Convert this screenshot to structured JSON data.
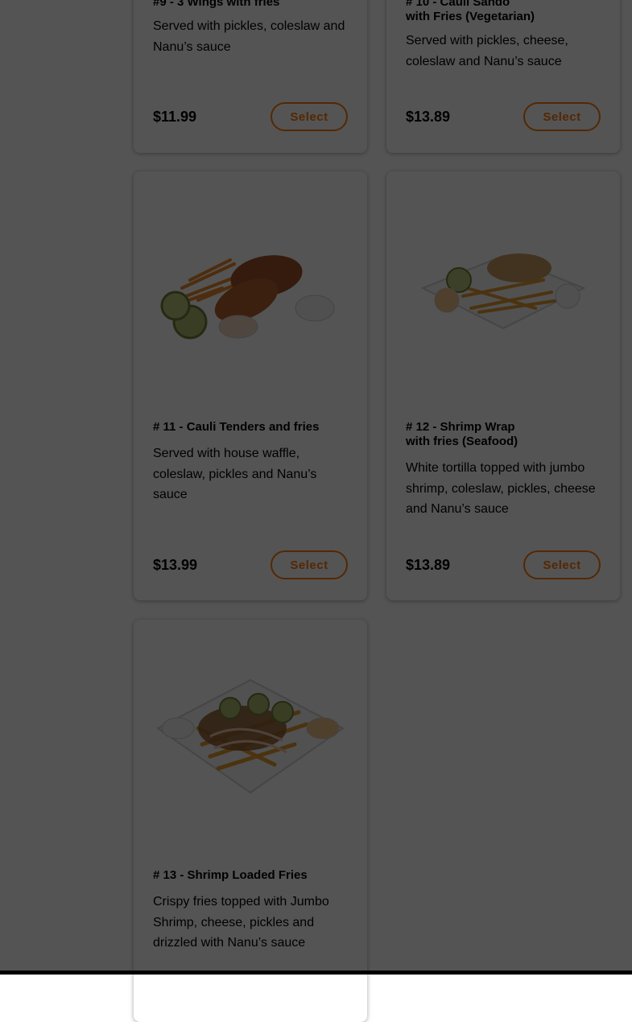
{
  "menu_items": [
    {
      "id": "item9",
      "title": "#9 - 3 Wings with fries",
      "description": "Served with pickles, coleslaw and Nanu’s sauce",
      "price": "$11.99",
      "select_label": "Select"
    },
    {
      "id": "item10",
      "title": "# 10 - Cauli Sando\nwith Fries (Vegetarian)",
      "description": "Served with pickles, cheese, coleslaw and Nanu’s sauce",
      "price": "$13.89",
      "select_label": "Select"
    },
    {
      "id": "item11",
      "title": "# 11 - Cauli Tenders and fries",
      "description": "Served with house waffle, coleslaw, pickles and Nanu’s sauce",
      "price": "$13.99",
      "select_label": "Select",
      "image_icon": "cauli-tenders-photo"
    },
    {
      "id": "item12",
      "title": "# 12 - Shrimp Wrap\nwith fries (Seafood)",
      "description": "White tortilla topped with jumbo shrimp, coleslaw, pickles, cheese and Nanu’s sauce",
      "price": "$13.89",
      "select_label": "Select",
      "image_icon": "shrimp-wrap-photo"
    },
    {
      "id": "item13",
      "title": "# 13 - Shrimp Loaded Fries",
      "description": "Crispy fries topped with Jumbo Shrimp, cheese, pickles and drizzled with Nanu’s sauce",
      "image_icon": "shrimp-loaded-fries-photo"
    }
  ],
  "colors": {
    "accent": "#fa7a0a",
    "overlay": "rgba(0,0,0,0.67)",
    "card_bg": "#ffffff"
  }
}
